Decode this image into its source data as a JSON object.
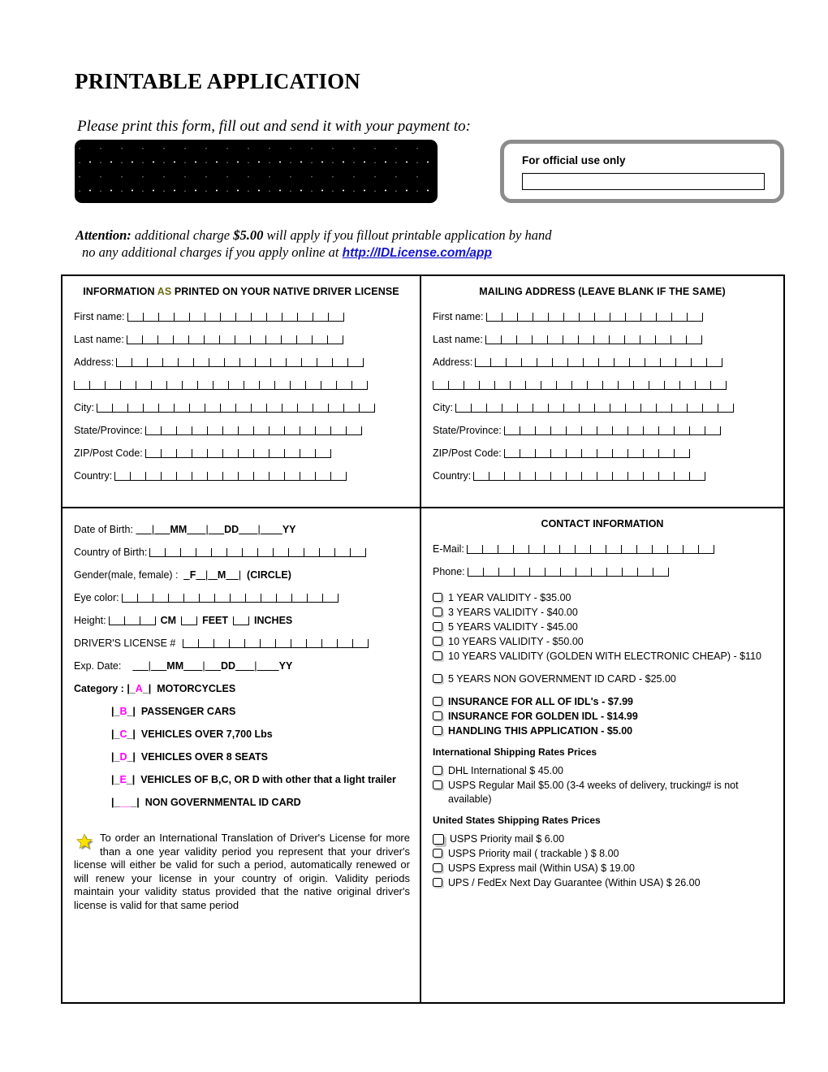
{
  "header": {
    "title": "PRINTABLE APPLICATION",
    "instruction": "Please print this form, fill out and send it with your payment to:",
    "redacted_block": "redacted-address-block"
  },
  "official_box": {
    "label": "For official use only",
    "input_value": ""
  },
  "attention": {
    "label": "Attention:",
    "line1_a": "additional charge",
    "amount": "$5.00",
    "line1_b": "will apply if you fillout printable application by hand",
    "line2": "no any additional charges if you apply online at",
    "link": "http://IDLicense.com/app"
  },
  "colors": {
    "highlight_as": "#6b6b10",
    "category_letter": "#ff00ff",
    "link": "#1414d2",
    "star": "#ffe000"
  },
  "section_native": {
    "heading_before": "INFORMATION ",
    "heading_highlight": "AS",
    "heading_after": " PRINTED ON YOUR  NATIVE DRIVER LICENSE",
    "fields": [
      {
        "label": "First name:",
        "cells": 14
      },
      {
        "label": "Last name:",
        "cells": 14
      },
      {
        "label": "Address:",
        "cells": 16
      },
      {
        "label": "",
        "cells": 19
      },
      {
        "label": "City:",
        "cells": 18
      },
      {
        "label": "State/Province:",
        "cells": 14
      },
      {
        "label": "ZIP/Post Code:",
        "cells": 12
      },
      {
        "label": "Country:",
        "cells": 15
      }
    ]
  },
  "section_mailing": {
    "heading": "MAILING ADDRESS (LEAVE BLANK IF THE SAME)",
    "fields": [
      {
        "label": "First name:",
        "cells": 14
      },
      {
        "label": "Last name:",
        "cells": 14
      },
      {
        "label": "Address:",
        "cells": 16
      },
      {
        "label": "",
        "cells": 19
      },
      {
        "label": "City:",
        "cells": 18
      },
      {
        "label": "State/Province:",
        "cells": 14
      },
      {
        "label": "ZIP/Post Code:",
        "cells": 12
      },
      {
        "label": "Country:",
        "cells": 15
      }
    ]
  },
  "section_details": {
    "dob_label": "Date of Birth:",
    "dob_mm": "MM",
    "dob_dd": "DD",
    "dob_yy": "YY",
    "country_of_birth_label": "Country of Birth:",
    "country_of_birth_cells": 14,
    "gender_label": "Gender(male, female) :",
    "gender_f": "F",
    "gender_m": "M",
    "gender_note": "(CIRCLE)",
    "eye_color_label": "Eye color:",
    "eye_color_cells": 14,
    "height_label": "Height:",
    "height_cm": "CM",
    "height_feet": "FEET",
    "height_inches": "INCHES",
    "license_label": "DRIVER'S LICENSE #",
    "license_cells": 12,
    "exp_label": "Exp. Date:",
    "exp_mm": "MM",
    "exp_dd": "DD",
    "exp_yy": "YY",
    "category_label": "Category :",
    "categories": [
      {
        "letter": "A",
        "text": "MOTORCYCLES"
      },
      {
        "letter": "B",
        "text": "PASSENGER CARS"
      },
      {
        "letter": "C",
        "text": "VEHICLES OVER 7,700  Lbs"
      },
      {
        "letter": "D",
        "text": "VEHICLES OVER 8 SEATS"
      },
      {
        "letter": "E",
        "text": "VEHICLES OF B,C, OR D with other that a light trailer"
      },
      {
        "letter": "",
        "text": "NON GOVERNMENTAL ID CARD"
      }
    ],
    "star_paragraph": "To order an International Translation of Driver's License for more than a one year validity period you represent that your driver's license will either be valid for such a period, automatically renewed or will renew your license in your country of origin. Validity periods maintain your validity status provided that the native original driver's license is valid for that same period"
  },
  "section_contact": {
    "heading": "CONTACT INFORMATION",
    "fields": [
      {
        "label": "E-Mail:",
        "cells": 16
      },
      {
        "label": "Phone:",
        "cells": 13
      }
    ],
    "validity_options": [
      {
        "text": "1 YEAR VALIDITY   -  $35.00",
        "checked": false
      },
      {
        "text": "3 YEARS VALIDITY  -  $40.00",
        "checked": false
      },
      {
        "text": "5 YEARS VALIDITY  -  $45.00",
        "checked": false
      },
      {
        "text": "10 YEARS VALIDITY -  $50.00",
        "checked": false
      },
      {
        "text": "10 YEARS VALIDITY (GOLDEN WITH ELECTRONIC CHEAP) - $110",
        "checked": false
      }
    ],
    "non_government_option": {
      "text": "5 YEARS NON GOVERNMENT ID CARD -  $25.00",
      "checked": false
    },
    "insurance_options": [
      {
        "text": "INSURANCE FOR ALL OF IDL's -   $7.99",
        "checked": false
      },
      {
        "text": "INSURANCE FOR GOLDEN IDL -  $14.99",
        "checked": false
      },
      {
        "text": "HANDLING THIS APPLICATION -   $5.00",
        "checked": false
      }
    ],
    "intl_shipping_title": "International Shipping Rates Prices",
    "intl_shipping_options": [
      {
        "text": "DHL International $ 45.00",
        "checked": false
      },
      {
        "text": "USPS Regular Mail $5.00 (3-4 weeks of delivery, trucking# is not available)",
        "checked": false
      }
    ],
    "us_shipping_title": "United States Shipping Rates Prices",
    "us_shipping_options": [
      {
        "text": "USPS Priority mail    $ 6.00",
        "checked": false
      },
      {
        "text": "USPS Priority mail ( trackable )  $ 8.00",
        "checked": false
      },
      {
        "text": "USPS Express mail (Within USA)  $ 19.00",
        "checked": false
      },
      {
        "text": "UPS / FedEx  Next Day Guarantee  (Within USA)   $ 26.00",
        "checked": false
      }
    ]
  }
}
